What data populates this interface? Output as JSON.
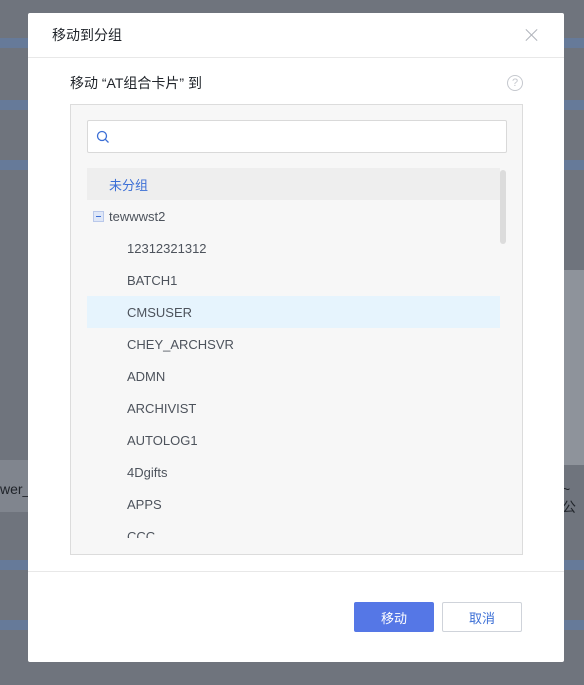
{
  "background": {
    "left_text": "wer_",
    "right_text": "~公"
  },
  "dialog": {
    "title": "移动到分组",
    "subtitle": "移动 “AT组合卡片” 到",
    "help_icon": "?",
    "search": {
      "placeholder": "",
      "value": ""
    },
    "tree": {
      "ungrouped_label": "未分组",
      "group_label": "tewwwst2",
      "children": [
        "12312321312",
        "BATCH1",
        "CMSUSER",
        "CHEY_ARCHSVR",
        "ADMN",
        "ARCHIVIST",
        "AUTOLOG1",
        "4Dgifts",
        "APPS",
        "CCC"
      ],
      "selected": "CMSUSER"
    },
    "buttons": {
      "confirm": "移动",
      "cancel": "取消"
    }
  },
  "colors": {
    "primary": "#5577e6",
    "link": "#3c6fd6",
    "selected_row": "#e6f4fd"
  }
}
